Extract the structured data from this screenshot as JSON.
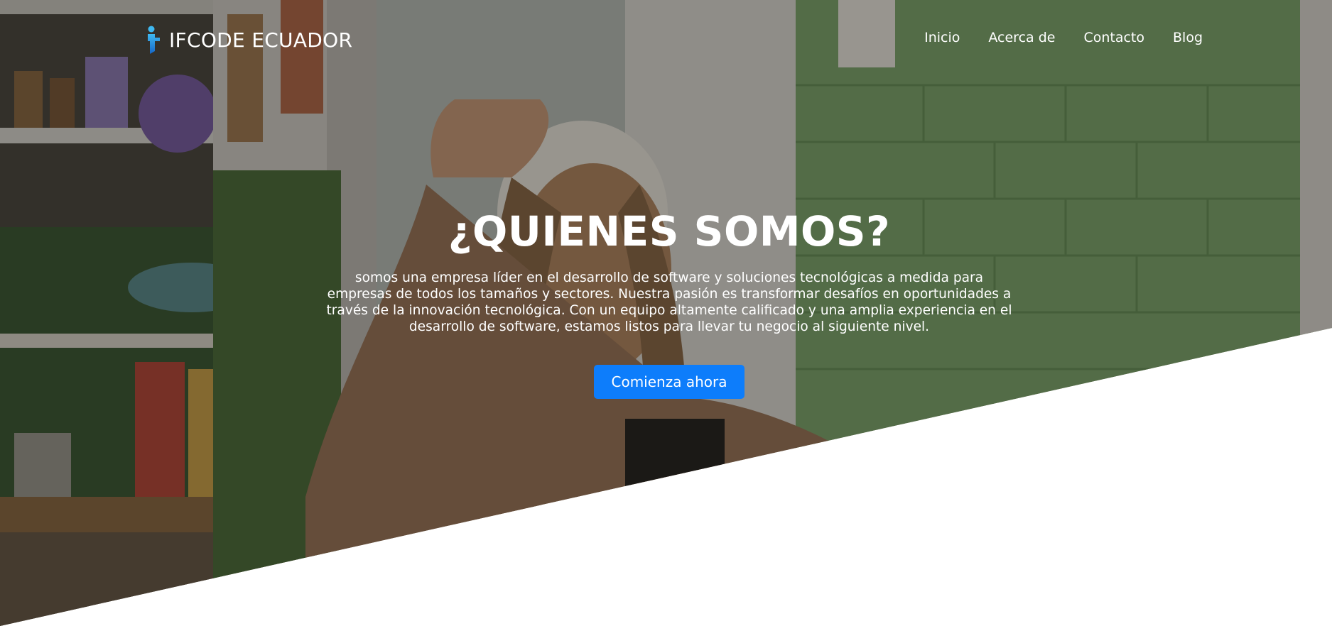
{
  "brand": {
    "name": "IFCODE ECUADOR",
    "logo_icon": "i-letter-logo-icon"
  },
  "nav": {
    "items": [
      {
        "label": "Inicio"
      },
      {
        "label": "Acerca de"
      },
      {
        "label": "Contacto"
      },
      {
        "label": "Blog"
      }
    ]
  },
  "hero": {
    "title": "¿QUIENES SOMOS?",
    "text": "somos una empresa líder en el desarrollo de software y soluciones tecnológicas a medida para empresas de todos los tamaños y sectores. Nuestra pasión es transformar desafíos en oportunidades a través de la innovación tecnológica. Con un equipo altamente calificado y una amplia experiencia en el desarrollo de software, estamos listos para llevar tu negocio al siguiente nivel.",
    "cta_label": "Comienza ahora",
    "background_image": "photo of a woman with braided hair wearing headphones in a kitchen with green walls"
  },
  "colors": {
    "accent": "#0d7dfb",
    "text_on_hero": "#ffffff",
    "page_background": "#ffffff"
  }
}
